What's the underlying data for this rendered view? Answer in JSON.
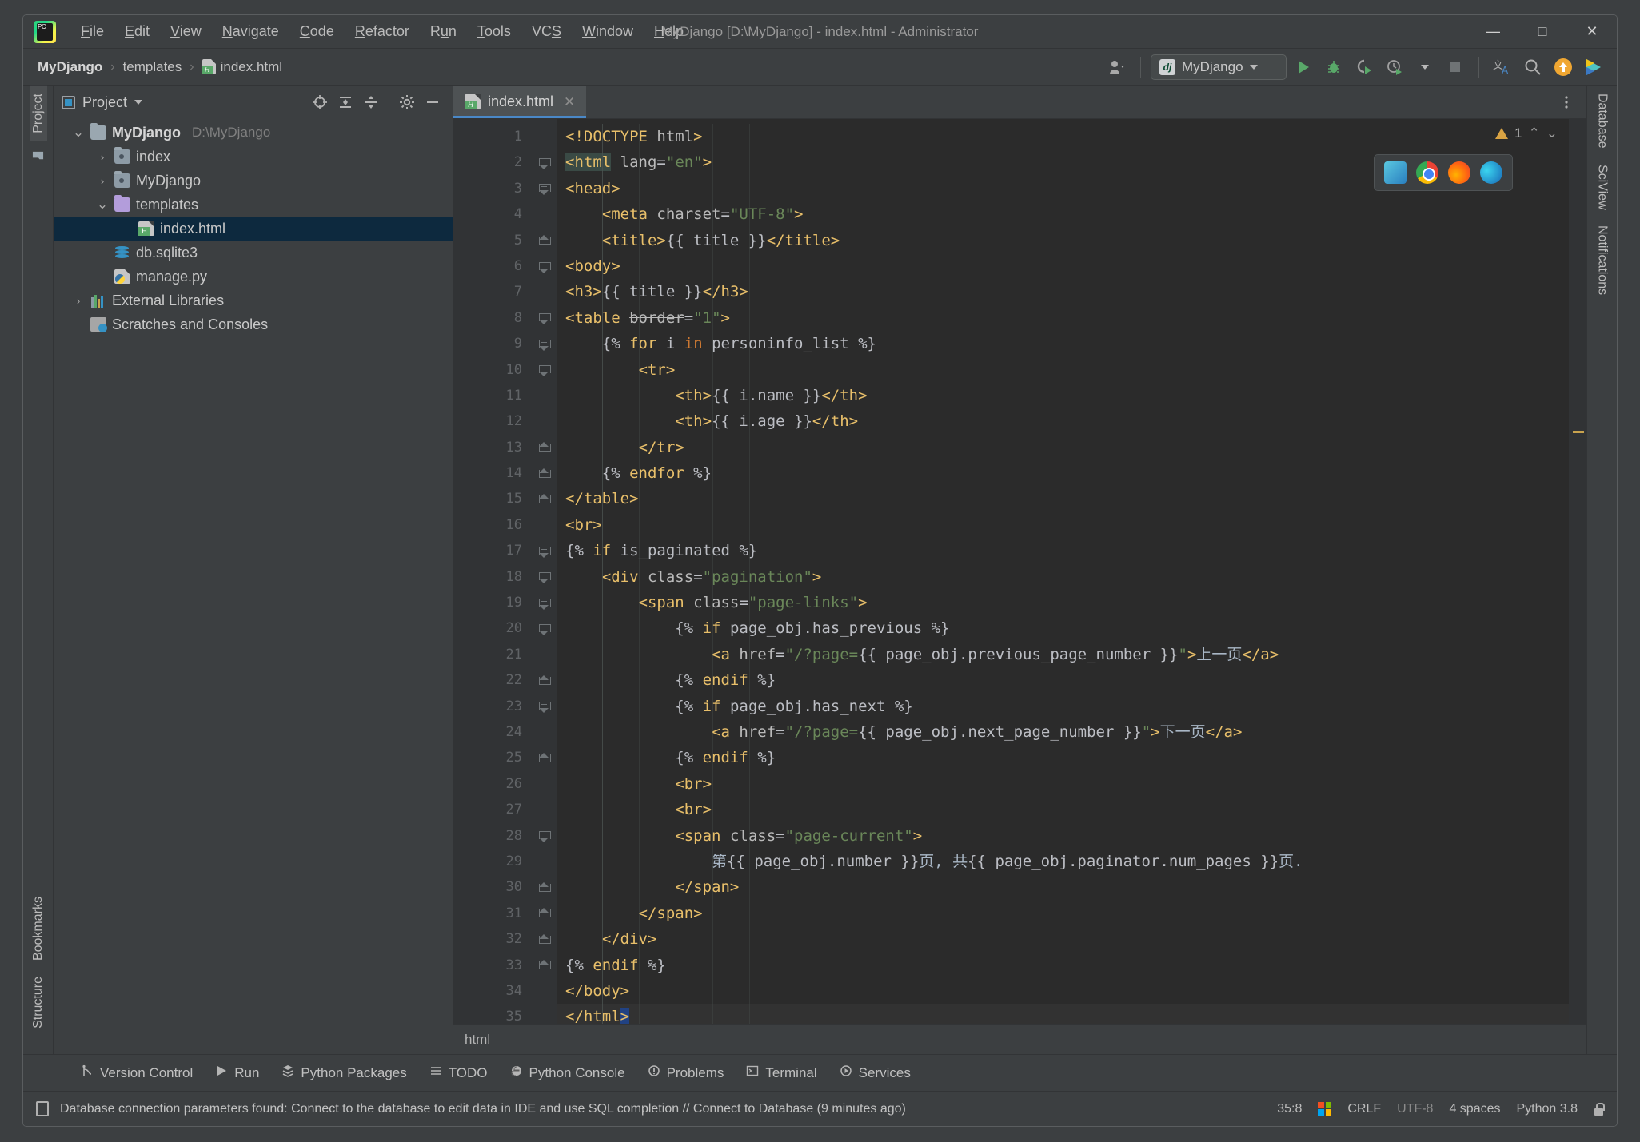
{
  "window": {
    "title": "MyDjango [D:\\MyDjango] - index.html - Administrator",
    "minimize": "—",
    "maximize": "□",
    "close": "✕"
  },
  "menu": [
    {
      "label": "File"
    },
    {
      "label": "Edit"
    },
    {
      "label": "View"
    },
    {
      "label": "Navigate"
    },
    {
      "label": "Code"
    },
    {
      "label": "Refactor"
    },
    {
      "label": "Run"
    },
    {
      "label": "Tools"
    },
    {
      "label": "VCS"
    },
    {
      "label": "Window"
    },
    {
      "label": "Help"
    }
  ],
  "navbar": {
    "breadcrumbs": [
      "MyDjango",
      "templates",
      "index.html"
    ],
    "separator": "›",
    "account_icon": "user-icon",
    "run_config": {
      "badge": "dj",
      "label": "MyDjango"
    },
    "buttons": [
      {
        "name": "run-button",
        "glyph": "▶"
      },
      {
        "name": "debug-button",
        "glyph": "🐞"
      },
      {
        "name": "run-coverage-button",
        "glyph": "▷"
      },
      {
        "name": "profiler-button",
        "glyph": "◔"
      },
      {
        "name": "stop-button",
        "glyph": "■"
      },
      {
        "name": "translate-button",
        "glyph": "文A"
      },
      {
        "name": "search-everywhere-button",
        "glyph": "🔍"
      },
      {
        "name": "update-button",
        "glyph": "↑"
      },
      {
        "name": "ai-assistant-button",
        "glyph": "▶"
      }
    ]
  },
  "left_strip": {
    "project_tab": "Project",
    "bookmarks_tab": "Bookmarks",
    "structure_tab": "Structure"
  },
  "right_strip": {
    "database_tab": "Database",
    "sciview_tab": "SciView",
    "notifications_tab": "Notifications"
  },
  "project_panel": {
    "title": "Project",
    "actions": [
      "locate-icon",
      "expand-all-icon",
      "collapse-all-icon",
      "settings-icon",
      "hide-icon"
    ],
    "tree": [
      {
        "label": "MyDjango",
        "sub": "D:\\MyDjango",
        "icon": "folder-icon",
        "arrow": "expanded",
        "indent": 0,
        "bold": true,
        "selected": false
      },
      {
        "label": "index",
        "sub": "",
        "icon": "module-folder-icon",
        "arrow": "collapsed",
        "indent": 1,
        "bold": false,
        "selected": false
      },
      {
        "label": "MyDjango",
        "sub": "",
        "icon": "module-folder-icon",
        "arrow": "collapsed",
        "indent": 1,
        "bold": false,
        "selected": false
      },
      {
        "label": "templates",
        "sub": "",
        "icon": "templates-folder-icon",
        "arrow": "expanded",
        "indent": 1,
        "bold": false,
        "selected": false
      },
      {
        "label": "index.html",
        "sub": "",
        "icon": "html-file-icon",
        "arrow": "none",
        "indent": 2,
        "bold": false,
        "selected": true
      },
      {
        "label": "db.sqlite3",
        "sub": "",
        "icon": "database-file-icon",
        "arrow": "none",
        "indent": 1,
        "bold": false,
        "selected": false
      },
      {
        "label": "manage.py",
        "sub": "",
        "icon": "python-file-icon",
        "arrow": "none",
        "indent": 1,
        "bold": false,
        "selected": false
      },
      {
        "label": "External Libraries",
        "sub": "",
        "icon": "library-icon",
        "arrow": "collapsed",
        "indent": 0,
        "bold": false,
        "selected": false
      },
      {
        "label": "Scratches and Consoles",
        "sub": "",
        "icon": "scratches-icon",
        "arrow": "none",
        "indent": 0,
        "bold": false,
        "selected": false
      }
    ]
  },
  "editor": {
    "tab": {
      "label": "index.html",
      "icon": "html-file-icon",
      "close": "✕"
    },
    "inspection": {
      "count": "1",
      "icon": "warning-triangle-icon"
    },
    "browser_popup": [
      "ie-icon",
      "chrome-icon",
      "firefox-icon",
      "edge-icon"
    ],
    "breadcrumb": "html",
    "lines": [
      {
        "n": "1",
        "fold": "none",
        "indent": 0,
        "text": "<!DOCTYPE html>"
      },
      {
        "n": "2",
        "fold": "open",
        "indent": 0,
        "text": "<html lang=\"en\">"
      },
      {
        "n": "3",
        "fold": "open",
        "indent": 0,
        "text": "<head>"
      },
      {
        "n": "4",
        "fold": "none",
        "indent": 1,
        "text": "<meta charset=\"UTF-8\">"
      },
      {
        "n": "5",
        "fold": "end",
        "indent": 1,
        "text": "<title>{{ title }}</title>"
      },
      {
        "n": "6",
        "fold": "open",
        "indent": 0,
        "text": "<body>"
      },
      {
        "n": "7",
        "fold": "none",
        "indent": 0,
        "text": "<h3>{{ title }}</h3>"
      },
      {
        "n": "8",
        "fold": "open",
        "indent": 0,
        "text": "<table border=\"1\">"
      },
      {
        "n": "9",
        "fold": "open",
        "indent": 1,
        "text": "{% for i in personinfo_list %}"
      },
      {
        "n": "10",
        "fold": "open",
        "indent": 2,
        "text": "<tr>"
      },
      {
        "n": "11",
        "fold": "none",
        "indent": 3,
        "text": "<th>{{ i.name }}</th>"
      },
      {
        "n": "12",
        "fold": "none",
        "indent": 3,
        "text": "<th>{{ i.age }}</th>"
      },
      {
        "n": "13",
        "fold": "end",
        "indent": 2,
        "text": "</tr>"
      },
      {
        "n": "14",
        "fold": "end",
        "indent": 1,
        "text": "{% endfor %}"
      },
      {
        "n": "15",
        "fold": "end",
        "indent": 0,
        "text": "</table>"
      },
      {
        "n": "16",
        "fold": "none",
        "indent": 0,
        "text": "<br>"
      },
      {
        "n": "17",
        "fold": "open",
        "indent": 0,
        "text": "{% if is_paginated %}"
      },
      {
        "n": "18",
        "fold": "open",
        "indent": 1,
        "text": "<div class=\"pagination\">"
      },
      {
        "n": "19",
        "fold": "open",
        "indent": 2,
        "text": "<span class=\"page-links\">"
      },
      {
        "n": "20",
        "fold": "open",
        "indent": 3,
        "text": "{% if page_obj.has_previous %}"
      },
      {
        "n": "21",
        "fold": "none",
        "indent": 4,
        "text": "<a href=\"/?page={{ page_obj.previous_page_number }}\">上一页</a>"
      },
      {
        "n": "22",
        "fold": "end",
        "indent": 3,
        "text": "{% endif %}"
      },
      {
        "n": "23",
        "fold": "open",
        "indent": 3,
        "text": "{% if page_obj.has_next %}"
      },
      {
        "n": "24",
        "fold": "none",
        "indent": 4,
        "text": "<a href=\"/?page={{ page_obj.next_page_number }}\">下一页</a>"
      },
      {
        "n": "25",
        "fold": "end",
        "indent": 3,
        "text": "{% endif %}"
      },
      {
        "n": "26",
        "fold": "none",
        "indent": 3,
        "text": "<br>"
      },
      {
        "n": "27",
        "fold": "none",
        "indent": 3,
        "text": "<br>"
      },
      {
        "n": "28",
        "fold": "open",
        "indent": 3,
        "text": "<span class=\"page-current\">"
      },
      {
        "n": "29",
        "fold": "none",
        "indent": 4,
        "text": "第{{ page_obj.number }}页, 共{{ page_obj.paginator.num_pages }}页."
      },
      {
        "n": "30",
        "fold": "end",
        "indent": 3,
        "text": "</span>"
      },
      {
        "n": "31",
        "fold": "end",
        "indent": 2,
        "text": "</span>"
      },
      {
        "n": "32",
        "fold": "end",
        "indent": 1,
        "text": "</div>"
      },
      {
        "n": "33",
        "fold": "end",
        "indent": 0,
        "text": "{% endif %}"
      },
      {
        "n": "34",
        "fold": "none",
        "indent": 0,
        "text": "</body>"
      },
      {
        "n": "35",
        "fold": "none",
        "indent": 0,
        "text": "</html>"
      }
    ]
  },
  "bottom_tools": [
    {
      "label": "Version Control",
      "icon": "branch-icon"
    },
    {
      "label": "Run",
      "icon": "run-icon"
    },
    {
      "label": "Python Packages",
      "icon": "packages-icon"
    },
    {
      "label": "TODO",
      "icon": "todo-icon"
    },
    {
      "label": "Python Console",
      "icon": "python-console-icon"
    },
    {
      "label": "Problems",
      "icon": "problems-icon"
    },
    {
      "label": "Terminal",
      "icon": "terminal-icon"
    },
    {
      "label": "Services",
      "icon": "services-icon"
    }
  ],
  "statusbar": {
    "message": "Database connection parameters found: Connect to the database to edit data in IDE and use SQL completion // Connect to Database (9 minutes ago)",
    "caret": "35:8",
    "line_separator": "CRLF",
    "encoding": "UTF-8",
    "indent": "4 spaces",
    "interpreter": "Python 3.8",
    "lock_icon": "lock-icon"
  },
  "colors": {
    "accent": "#4a88c7",
    "selection": "#0d293e",
    "editor_bg": "#2b2b2b",
    "panel_bg": "#3c3f41",
    "tag": "#e8bf6a",
    "string": "#6a8759",
    "keyword": "#cc7832"
  }
}
